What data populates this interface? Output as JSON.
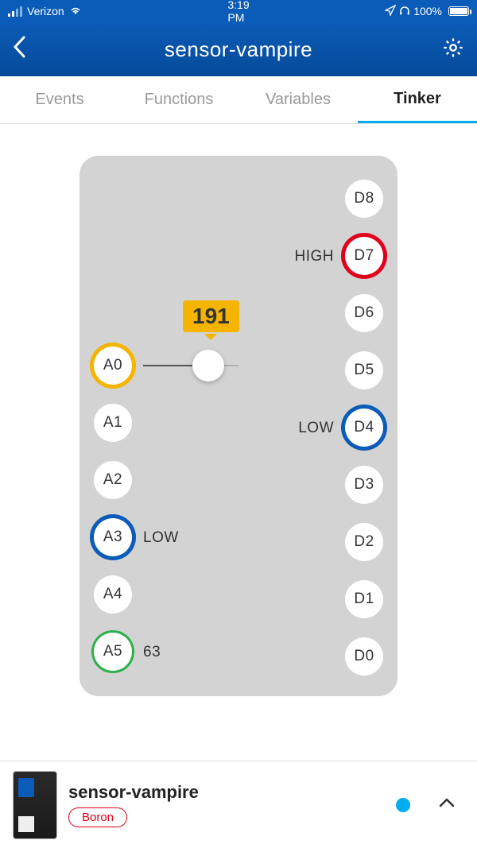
{
  "status_bar": {
    "carrier": "Verizon",
    "time": "3:19 PM",
    "battery_pct": "100%"
  },
  "header": {
    "title": "sensor-vampire"
  },
  "tabs": [
    {
      "label": "Events",
      "active": false
    },
    {
      "label": "Functions",
      "active": false
    },
    {
      "label": "Variables",
      "active": false
    },
    {
      "label": "Tinker",
      "active": true
    }
  ],
  "slider": {
    "value": "191"
  },
  "pins_left": [
    {
      "id": "A0",
      "ring": "yellow",
      "value_label": ""
    },
    {
      "id": "A1",
      "ring": "",
      "value_label": ""
    },
    {
      "id": "A2",
      "ring": "",
      "value_label": ""
    },
    {
      "id": "A3",
      "ring": "blue",
      "value_label": "LOW"
    },
    {
      "id": "A4",
      "ring": "",
      "value_label": ""
    },
    {
      "id": "A5",
      "ring": "green",
      "value_label": "63"
    }
  ],
  "pins_right": [
    {
      "id": "D8",
      "ring": "",
      "value_label": ""
    },
    {
      "id": "D7",
      "ring": "red",
      "value_label": "HIGH"
    },
    {
      "id": "D6",
      "ring": "",
      "value_label": ""
    },
    {
      "id": "D5",
      "ring": "",
      "value_label": ""
    },
    {
      "id": "D4",
      "ring": "blue",
      "value_label": "LOW"
    },
    {
      "id": "D3",
      "ring": "",
      "value_label": ""
    },
    {
      "id": "D2",
      "ring": "",
      "value_label": ""
    },
    {
      "id": "D1",
      "ring": "",
      "value_label": ""
    },
    {
      "id": "D0",
      "ring": "",
      "value_label": ""
    }
  ],
  "footer": {
    "device_name": "sensor-vampire",
    "device_type": "Boron",
    "online": true
  }
}
